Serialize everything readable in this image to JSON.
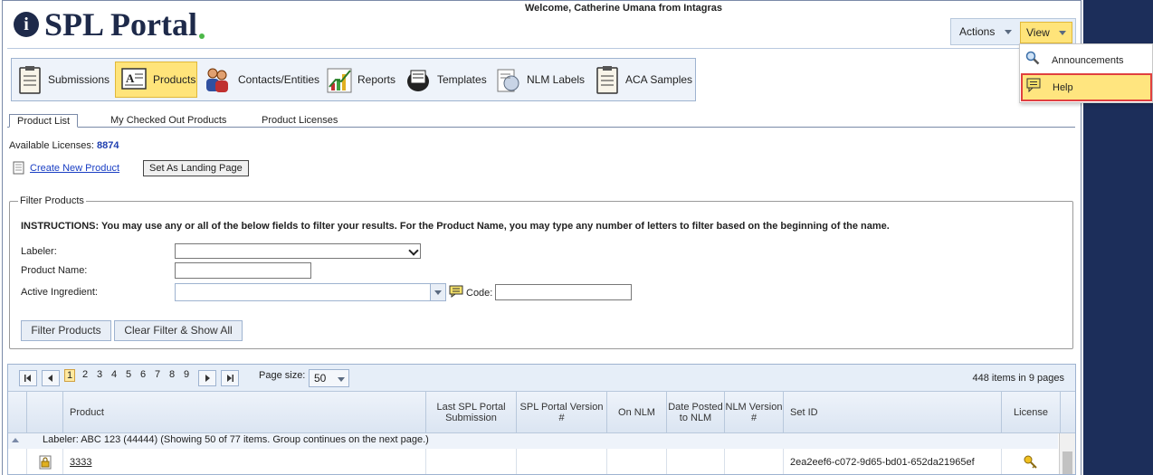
{
  "header": {
    "app_title": "SPL Portal",
    "logo_letter": "i",
    "welcome": "Welcome, Catherine Umana from Intagras",
    "actions_label": "Actions",
    "view_label": "View"
  },
  "view_menu": {
    "items": [
      {
        "label": "Announcements",
        "icon": "magnifier-icon"
      },
      {
        "label": "Help",
        "icon": "help-note-icon",
        "highlighted": true
      }
    ]
  },
  "toolbar": {
    "items": [
      {
        "label": "Submissions",
        "icon": "clipboard-icon"
      },
      {
        "label": "Products",
        "icon": "document-icon",
        "active": true
      },
      {
        "label": "Contacts/Entities",
        "icon": "people-icon"
      },
      {
        "label": "Reports",
        "icon": "chart-icon"
      },
      {
        "label": "Templates",
        "icon": "rolodex-icon"
      },
      {
        "label": "NLM Labels",
        "icon": "label-icon"
      },
      {
        "label": "ACA Samples",
        "icon": "checklist-icon"
      }
    ]
  },
  "tabs": [
    "Product List",
    "My Checked Out Products",
    "Product Licenses"
  ],
  "licenses": {
    "label": "Available Licenses:",
    "value": "8874"
  },
  "create_link": "Create New Product",
  "landing_button": "Set As Landing Page",
  "filter": {
    "legend": "Filter Products",
    "instructions": "INSTRUCTIONS: You may use any or all of the below fields to filter your results. For the Product Name, you may type any number of letters to filter based on the beginning of the name.",
    "labeler_label": "Labeler:",
    "labeler_value": "",
    "product_name_label": "Product Name:",
    "product_name_value": "",
    "ingredient_label": "Active Ingredient:",
    "ingredient_value": "",
    "code_label": "Code:",
    "code_value": "",
    "filter_button": "Filter Products",
    "clear_button": "Clear Filter & Show All"
  },
  "grid": {
    "pages": [
      "1",
      "2",
      "3",
      "4",
      "5",
      "6",
      "7",
      "8",
      "9"
    ],
    "current_page": "1",
    "page_size_label": "Page size:",
    "page_size": "50",
    "items_info": "448 items in 9 pages",
    "columns": [
      "Product",
      "Last SPL Portal Submission",
      "SPL Portal Version #",
      "On NLM",
      "Date Posted to NLM",
      "NLM Version #",
      "Set ID",
      "License"
    ],
    "group_text": "Labeler: ABC 123 (44444) (Showing 50 of 77 items. Group continues on the next page.)",
    "rows": [
      {
        "product": "3333",
        "last_submission": "",
        "version": "",
        "on_nlm": "",
        "date_posted": "",
        "nlm_version": "",
        "set_id": "2ea2eef6-c072-9d65-bd01-652da21965ef"
      }
    ]
  },
  "colors": {
    "accent_yellow": "#ffe47a",
    "highlight_border": "#e04040",
    "brand_navy": "#1e2a4a",
    "brand_green": "#4cb848",
    "side_bar": "#1c2e5a"
  }
}
